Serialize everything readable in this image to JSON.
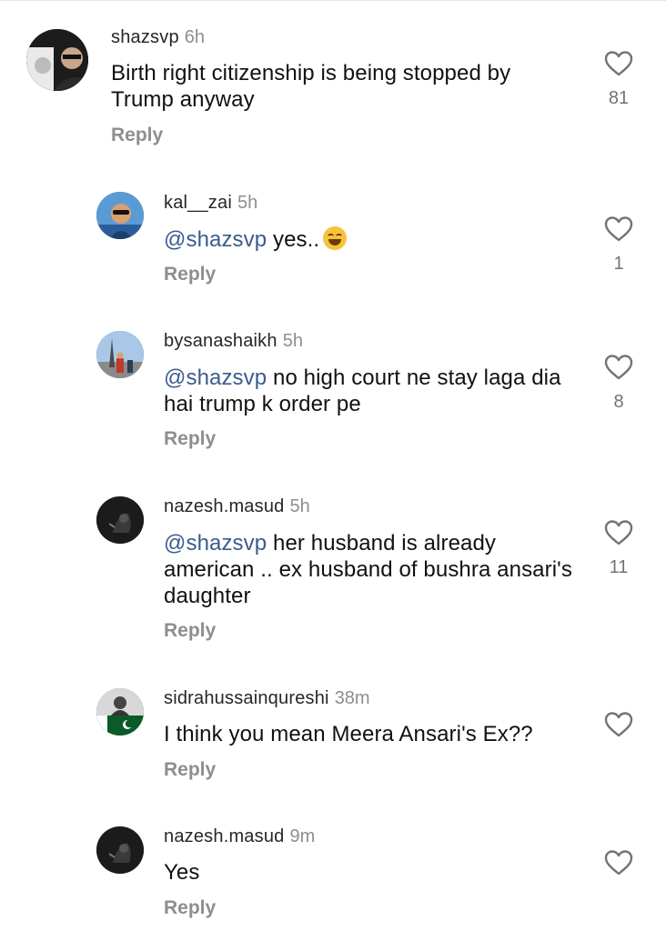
{
  "reply_label": "Reply",
  "comments": [
    {
      "username": "shazsvp",
      "time": "6h",
      "mention": "",
      "text": "Birth right citizenship is being stopped by Trump anyway",
      "likes": "81",
      "avatar_icon": "profile-photo"
    },
    {
      "username": "kal__zai",
      "time": "5h",
      "mention": "@shazsvp",
      "text": "yes..",
      "emoji": "face-with-tears-of-joy",
      "likes": "1",
      "avatar_icon": "profile-photo"
    },
    {
      "username": "bysanashaikh",
      "time": "5h",
      "mention": "@shazsvp",
      "text": "no high court ne stay laga dia hai trump k order pe",
      "likes": "8",
      "avatar_icon": "profile-photo"
    },
    {
      "username": "nazesh.masud",
      "time": "5h",
      "mention": "@shazsvp",
      "text": "her husband is already american .. ex husband of bushra ansari's daughter",
      "likes": "11",
      "avatar_icon": "profile-photo"
    },
    {
      "username": "sidrahussainqureshi",
      "time": "38m",
      "mention": "",
      "text": "I think you mean Meera Ansari's Ex??",
      "likes": "",
      "avatar_icon": "profile-photo"
    },
    {
      "username": "nazesh.masud",
      "time": "9m",
      "mention": "",
      "text": "Yes",
      "likes": "",
      "avatar_icon": "profile-photo"
    }
  ],
  "colors": {
    "text": "#111111",
    "muted": "#8e8e8e",
    "mention": "#3b5b8e"
  }
}
